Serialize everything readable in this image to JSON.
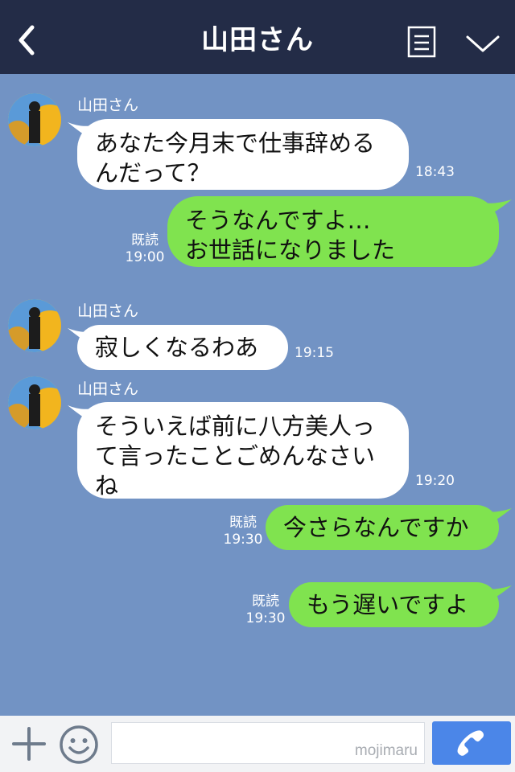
{
  "header": {
    "title": "山田さん",
    "back_icon": "chevron-left-icon",
    "menu_icon": "note-list-icon",
    "expand_icon": "chevron-down-icon"
  },
  "messages": [
    {
      "direction": "in",
      "sender": "山田さん",
      "lines": [
        "あなた今月末で仕事辞める",
        "んだって？"
      ],
      "time": "18:43"
    },
    {
      "direction": "out",
      "read": "既読",
      "lines": [
        "そうなんですよ…",
        "お世話になりました"
      ],
      "time": "19:00"
    },
    {
      "direction": "in",
      "sender": "山田さん",
      "lines": [
        "寂しくなるわあ"
      ],
      "time": "19:15"
    },
    {
      "direction": "in",
      "sender": "山田さん",
      "lines": [
        "そういえば前に八方美人っ",
        "て言ったことごめんなさい",
        "ね"
      ],
      "time": "19:20"
    },
    {
      "direction": "out",
      "read": "既読",
      "lines": [
        "今さらなんですか"
      ],
      "time": "19:30"
    },
    {
      "direction": "out",
      "read": "既読",
      "lines": [
        "もう遅いですよ"
      ],
      "time": "19:30"
    }
  ],
  "footer": {
    "watermark": "mojimaru",
    "input_value": "",
    "plus_icon": "plus-icon",
    "sticker_icon": "smiley-icon",
    "call_icon": "phone-icon"
  },
  "colors": {
    "header_bg": "#232c47",
    "chat_bg": "#7293c4",
    "outgoing_bubble": "#80e34f",
    "incoming_bubble": "#ffffff",
    "call_button": "#4b86e8"
  }
}
